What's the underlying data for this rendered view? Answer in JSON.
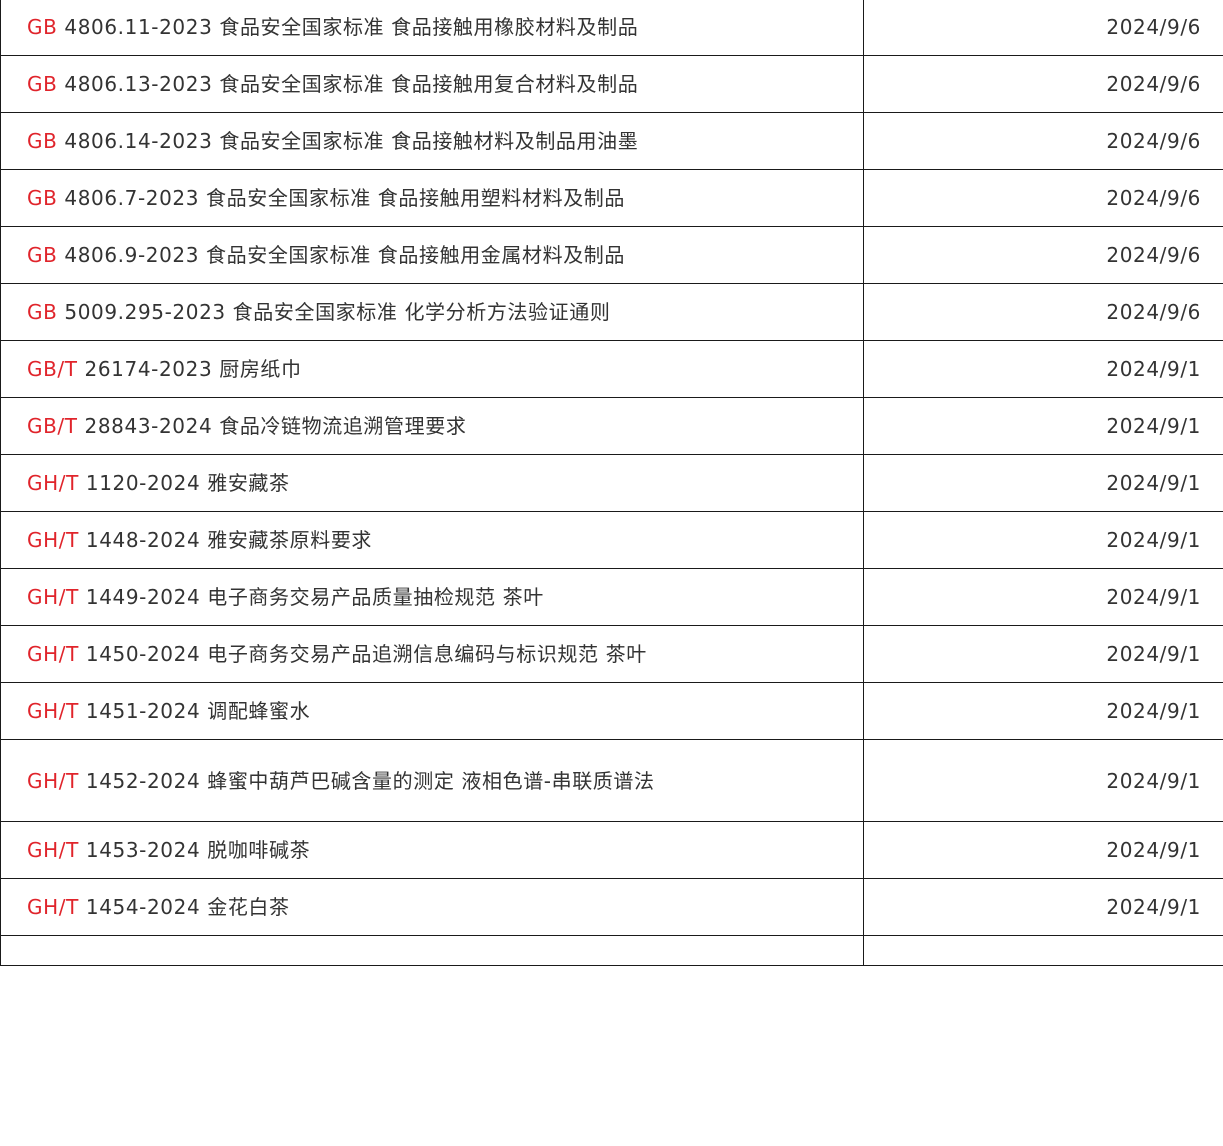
{
  "table": {
    "rows": [
      {
        "prefix": "GB",
        "rest": " 4806.11-2023 食品安全国家标准 食品接触用橡胶材料及制品",
        "date": "2024/9/6"
      },
      {
        "prefix": "GB",
        "rest": " 4806.13-2023 食品安全国家标准 食品接触用复合材料及制品",
        "date": "2024/9/6"
      },
      {
        "prefix": "GB",
        "rest": " 4806.14-2023 食品安全国家标准 食品接触材料及制品用油墨",
        "date": "2024/9/6"
      },
      {
        "prefix": "GB",
        "rest": " 4806.7-2023 食品安全国家标准 食品接触用塑料材料及制品",
        "date": "2024/9/6"
      },
      {
        "prefix": "GB",
        "rest": " 4806.9-2023 食品安全国家标准 食品接触用金属材料及制品",
        "date": "2024/9/6"
      },
      {
        "prefix": "GB",
        "rest": " 5009.295-2023 食品安全国家标准 化学分析方法验证通则",
        "date": "2024/9/6"
      },
      {
        "prefix": "GB/T",
        "rest": " 26174-2023 厨房纸巾",
        "date": "2024/9/1"
      },
      {
        "prefix": "GB/T",
        "rest": " 28843-2024 食品冷链物流追溯管理要求",
        "date": "2024/9/1"
      },
      {
        "prefix": "GH/T",
        "rest": " 1120-2024 雅安藏茶",
        "date": "2024/9/1"
      },
      {
        "prefix": "GH/T",
        "rest": " 1448-2024 雅安藏茶原料要求",
        "date": "2024/9/1"
      },
      {
        "prefix": "GH/T",
        "rest": " 1449-2024 电子商务交易产品质量抽检规范 茶叶",
        "date": "2024/9/1"
      },
      {
        "prefix": "GH/T",
        "rest": " 1450-2024 电子商务交易产品追溯信息编码与标识规范 茶叶",
        "date": "2024/9/1"
      },
      {
        "prefix": "GH/T",
        "rest": " 1451-2024 调配蜂蜜水",
        "date": "2024/9/1"
      },
      {
        "prefix": "GH/T",
        "rest": " 1452-2024 蜂蜜中葫芦巴碱含量的测定 液相色谱-串联质谱法",
        "date": "2024/9/1"
      },
      {
        "prefix": "GH/T",
        "rest": " 1453-2024 脱咖啡碱茶",
        "date": "2024/9/1"
      },
      {
        "prefix": "GH/T",
        "rest": " 1454-2024 金花白茶",
        "date": "2024/9/1"
      }
    ]
  },
  "colors": {
    "prefix": "#e0242b",
    "text": "#333333",
    "border": "#1a1a1a"
  }
}
